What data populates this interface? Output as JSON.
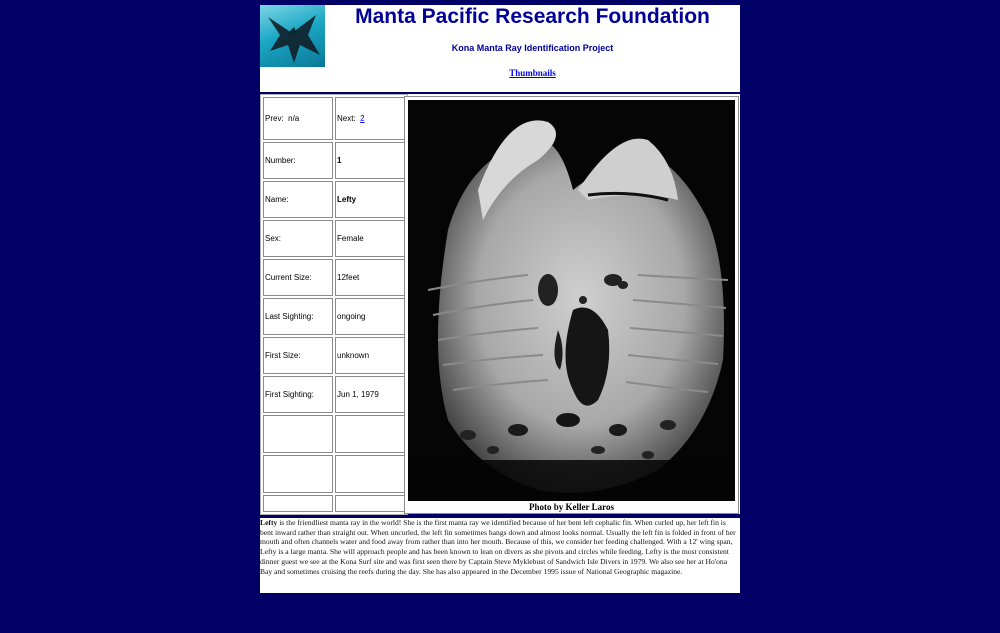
{
  "header": {
    "title": "Manta Pacific Research Foundation",
    "subtitle": "Kona Manta Ray Identification Project",
    "thumbnails_link": "Thumbnails"
  },
  "record": {
    "prev_label": "Prev:",
    "prev_value": "n/a",
    "next_label": "Next:",
    "next_value": "2",
    "rows": [
      {
        "label": "Number:",
        "value": "1"
      },
      {
        "label": "Name:",
        "value": "Lefty"
      },
      {
        "label": "Sex:",
        "value": "Female"
      },
      {
        "label": "Current Size:",
        "value": "12feet"
      },
      {
        "label": "Last Sighting:",
        "value": "ongoing"
      },
      {
        "label": "First Size:",
        "value": "unknown"
      },
      {
        "label": "First Sighting:",
        "value": "Jun 1, 1979"
      }
    ]
  },
  "photo": {
    "caption": "Photo by Keller Laros"
  },
  "description": {
    "name": "Lefty",
    "text": " is the friendliest manta ray in the world! She is the first manta ray we identified because of her bent left cephalic fin. When curled up, her left fin is bent inward rather than straight out. When uncurled, the left fin sometimes hangs down and almost looks normal. Usually the left fin is folded in front of her mouth and often channels water and food away from rather than into her mouth. Because of this, we consider her feeding challenged. With a 12' wing span, Lefty is a large manta. She will approach people and has been known to lean on divers as she pivots and circles while feeding. Lefty is the most consistent dinner guest we see at the Kona Surf site and was first seen there by Captain Steve Myklebust of Sandwich Isle Divers in 1979. We also see her at Ho'ona Bay and sometimes cruising the reefs during the day. She has also appeared in the December 1995 issue of National Geographic magazine."
  }
}
